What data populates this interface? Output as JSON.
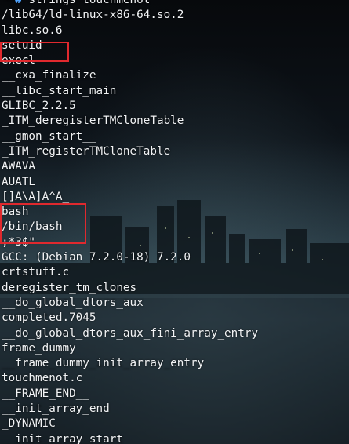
{
  "terminal": {
    "prompt": {
      "corner": "└─",
      "symbol": "#",
      "command": "strings touchmenot"
    },
    "output_lines": [
      "/lib64/ld-linux-x86-64.so.2",
      "libc.so.6",
      "setuid",
      "execl",
      "__cxa_finalize",
      "__libc_start_main",
      "GLIBC_2.2.5",
      "_ITM_deregisterTMCloneTable",
      "__gmon_start__",
      "_ITM_registerTMCloneTable",
      "AWAVA",
      "AUATL",
      "[]A\\A]A^A_",
      "bash",
      "/bin/bash",
      ";*3$\"",
      "GCC: (Debian 7.2.0-18) 7.2.0",
      "crtstuff.c",
      "deregister_tm_clones",
      "__do_global_dtors_aux",
      "completed.7045",
      "__do_global_dtors_aux_fini_array_entry",
      "frame_dummy",
      "__frame_dummy_init_array_entry",
      "touchmenot.c",
      "__FRAME_END__",
      "__init_array_end",
      "_DYNAMIC",
      "__init_array_start"
    ],
    "highlight_color": "#e0292e",
    "prompt_color": "#4fa3ff",
    "text_color": "#f1f3f5"
  }
}
